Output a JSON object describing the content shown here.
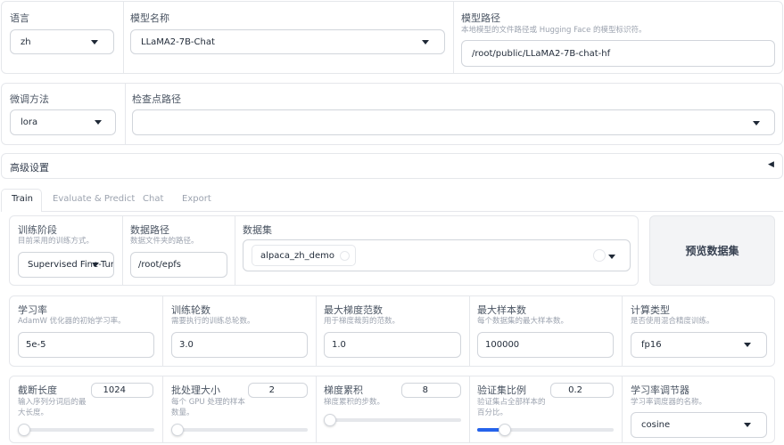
{
  "top": {
    "lang_label": "语言",
    "lang_value": "zh",
    "model_name_label": "模型名称",
    "model_name_value": "LLaMA2-7B-Chat",
    "model_path_label": "模型路径",
    "model_path_info": "本地模型的文件路径或 Hugging Face 的模型标识符。",
    "model_path_value": "/root/public/LLaMA2-7B-chat-hf"
  },
  "second": {
    "finetune_label": "微调方法",
    "finetune_value": "lora",
    "checkpoint_label": "检查点路径",
    "checkpoint_value": ""
  },
  "advanced": {
    "label": "高级设置",
    "toggle_glyph": "◀"
  },
  "tabs": [
    "Train",
    "Evaluate & Predict",
    "Chat",
    "Export"
  ],
  "train": {
    "stage_label": "训练阶段",
    "stage_info": "目前采用的训练方式。",
    "stage_value": "Supervised Fine-Tur",
    "data_dir_label": "数据路径",
    "data_dir_info": "数据文件夹的路径。",
    "data_dir_value": "/root/epfs",
    "dataset_label": "数据集",
    "dataset_chip": "alpaca_zh_demo",
    "preview_button": "预览数据集"
  },
  "row3": {
    "lr_label": "学习率",
    "lr_info": "AdamW 优化器的初始学习率。",
    "lr_value": "5e-5",
    "epochs_label": "训练轮数",
    "epochs_info": "需要执行的训练总轮数。",
    "epochs_value": "3.0",
    "max_grad_label": "最大梯度范数",
    "max_grad_info": "用于梯度裁剪的范数。",
    "max_grad_value": "1.0",
    "max_samples_label": "最大样本数",
    "max_samples_info": "每个数据集的最大样本数。",
    "max_samples_value": "100000",
    "compute_label": "计算类型",
    "compute_info": "是否使用混合精度训练。",
    "compute_value": "fp16"
  },
  "row4": {
    "cutoff_label": "截断长度",
    "cutoff_info_1": "输入序列分词后的最",
    "cutoff_info_2": "大长度。",
    "cutoff_value": "1024",
    "cutoff_fraction": 0.0,
    "batch_label": "批处理大小",
    "batch_info_1": "每个 GPU 处理的样本",
    "batch_info_2": "数量。",
    "batch_value": "2",
    "batch_fraction": 0.0,
    "grad_accum_label": "梯度累积",
    "grad_accum_info": "梯度累积的步数。",
    "grad_accum_value": "8",
    "grad_accum_fraction": 0.0,
    "val_size_label": "验证集比例",
    "val_size_info_1": "验证集占全部样本的",
    "val_size_info_2": "百分比。",
    "val_size_value": "0.2",
    "val_size_fraction": 0.2,
    "scheduler_label": "学习率调节器",
    "scheduler_info": "学习率调度器的名称。",
    "scheduler_value": "cosine"
  },
  "colors": {
    "accent": "#2563eb",
    "border": "#e5e7eb"
  }
}
